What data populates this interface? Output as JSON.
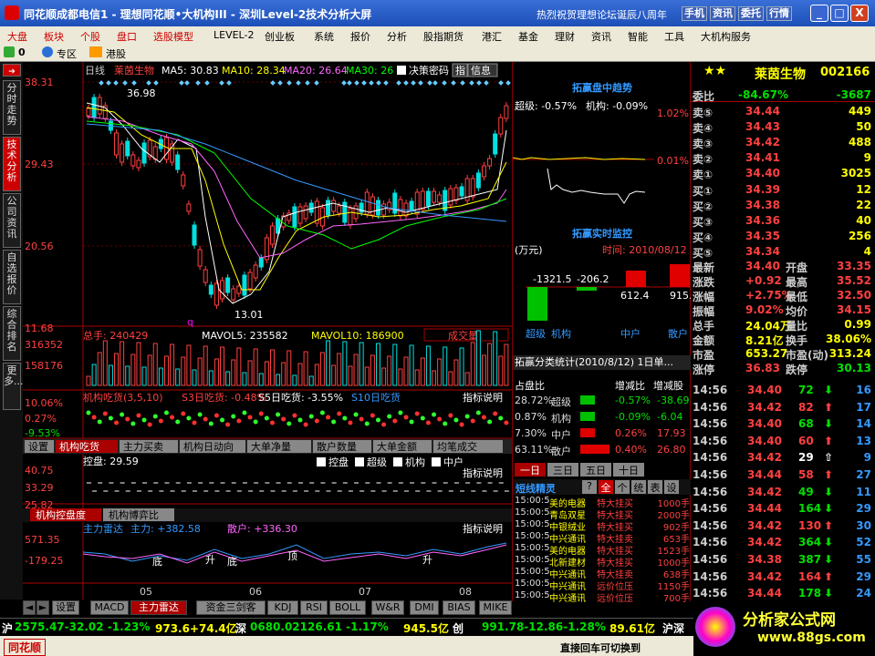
{
  "window": {
    "title": "同花顺成都电信1 - 理想同花顺•大机构III - 深圳Level-2技术分析大屏",
    "promo": "热烈祝贺理想论坛诞辰八周年",
    "buttons": [
      "手机",
      "资讯",
      "委托",
      "行情"
    ],
    "controls": [
      "_",
      "□",
      "X"
    ]
  },
  "menu": [
    "大盘",
    "板块",
    "个股",
    "盘口",
    "选股模型",
    "LEVEL-2",
    "创业板",
    "系统",
    "报价",
    "分析",
    "股指期货",
    "港汇",
    "基金",
    "理财",
    "资讯",
    "智能",
    "工具",
    "大机构服务"
  ],
  "toolbar": {
    "count": "0",
    "zone": "专区",
    "hk": "港股"
  },
  "left_tabs": [
    "分时走势",
    "技术分析",
    "公司资讯",
    "自选报价",
    "综合排名",
    "更多..."
  ],
  "chart": {
    "header_label": "日线",
    "stock": "莱茵生物",
    "ma5": "MA5: 30.83",
    "ma10": "MA10: 28.34",
    "ma20": "MA20: 26.64",
    "ma30": "MA30: 26",
    "toggle": "决策密码",
    "tool1": "指",
    "tool2": "信息",
    "prices": [
      "38.31",
      "29.43",
      "20.56",
      "11.68"
    ],
    "hi_label": "36.98",
    "lo_label": "13.01",
    "q_mark": "q",
    "vol_header": "总手: 240429",
    "mavol5": "MAVOL5: 235582",
    "mavol10": "MAVOL10: 186900",
    "vol_btn": "成交量",
    "vol_ticks": [
      "316352",
      "158176"
    ],
    "jg_header": "机构吃货(3,5,10)",
    "s3": "S3日吃货: -0.48%",
    "s5": "S5日吃货: -3.55%",
    "s10": "S10日吃货",
    "explain": "指标说明",
    "jg_ticks": [
      "10.06%",
      "0.27%",
      "-9.53%"
    ],
    "sub_tabs": [
      "设置",
      "机构吃货",
      "主力买卖",
      "机构日动向",
      "大单净量",
      "散户数量",
      "大单金额",
      "均笔成交"
    ],
    "kp_header": "控盘: 29.59",
    "kp_checks": [
      "控盘",
      "超级",
      "机构",
      "中户"
    ],
    "kp_ticks": [
      "40.75",
      "33.29",
      "25.82"
    ],
    "lower_tabs": [
      "机构控盘度",
      "机构博弈比"
    ],
    "ld_header": "主力雷达",
    "ld_main": "主力: +382.58",
    "ld_retail": "散户: +336.30",
    "ld_ticks": [
      "571.35",
      "-179.25"
    ],
    "ld_marks": [
      "底",
      "升",
      "底",
      "顶",
      "升"
    ],
    "x_labels": [
      "05",
      "06",
      "07",
      "08"
    ]
  },
  "bottom_tabs": [
    "设置",
    "MACD",
    "主力雷达",
    "资金三剑客",
    "KDJ",
    "RSI",
    "BOLL",
    "W&R",
    "DMI",
    "BIAS",
    "MIKE"
  ],
  "mid": {
    "intraday_title": "拓赢盘中趋势",
    "super": "超级: -0.57%",
    "inst": "机构: -0.09%",
    "pct_hi": "1.02%",
    "pct_mid": "0.01%",
    "monitor_title": "拓赢实时监控",
    "unit": "(万元)",
    "time": "时间: 2010/08/12",
    "vals": [
      "-1321.5",
      "-206.2",
      "612.4",
      "915."
    ],
    "cats": [
      "超级",
      "机构",
      "中户",
      "散户"
    ],
    "stat_title": "拓赢分类统计(2010/8/12) 1日单...",
    "stat_head": [
      "占盘比",
      "增减比",
      "增减股"
    ],
    "stat_rows": [
      [
        "28.72%",
        "超级",
        "-0.57%",
        "-38.69"
      ],
      [
        "0.87%",
        "机构",
        "-0.09%",
        "-6.04"
      ],
      [
        "7.30%",
        "中户",
        "0.26%",
        "17.93"
      ],
      [
        "63.11%",
        "散户",
        "0.40%",
        "26.80"
      ]
    ],
    "day_tabs": [
      "一日",
      "三日",
      "五日",
      "十日"
    ],
    "elf_title": "短线精灵",
    "elf_btns": [
      "?",
      "全",
      "个",
      "统",
      "表",
      "设"
    ],
    "elf_rows": [
      [
        "15:00:5",
        "美的电器",
        "特大挂买",
        "1000手"
      ],
      [
        "15:00:5",
        "青岛双星",
        "特大挂买",
        "2000手"
      ],
      [
        "15:00:5",
        "中银绒业",
        "特大挂买",
        "902手"
      ],
      [
        "15:00:5",
        "中兴通讯",
        "特大挂卖",
        "653手"
      ],
      [
        "15:00:5",
        "美的电器",
        "特大挂买",
        "1523手"
      ],
      [
        "15:00:5",
        "北新建材",
        "特大挂买",
        "1000手"
      ],
      [
        "15:00:5",
        "中兴通讯",
        "特大挂卖",
        "638手"
      ],
      [
        "15:00:5",
        "中兴通讯",
        "远价位压",
        "1150手"
      ],
      [
        "15:00:5",
        "中兴通讯",
        "远价位压",
        "700手"
      ]
    ]
  },
  "quote": {
    "name": "莱茵生物",
    "code": "002166",
    "webi_lab": "委比",
    "webi": "-84.67%",
    "weicha": "-3687",
    "sells": [
      [
        "卖⑤",
        "34.44",
        "449"
      ],
      [
        "卖④",
        "34.43",
        "50"
      ],
      [
        "卖③",
        "34.42",
        "488"
      ],
      [
        "卖②",
        "34.41",
        "9"
      ],
      [
        "卖①",
        "34.40",
        "3025"
      ]
    ],
    "buys": [
      [
        "买①",
        "34.39",
        "12"
      ],
      [
        "买②",
        "34.38",
        "22"
      ],
      [
        "买③",
        "34.36",
        "40"
      ],
      [
        "买④",
        "34.35",
        "256"
      ],
      [
        "买⑤",
        "34.34",
        "4"
      ]
    ],
    "stats": [
      [
        "最新",
        "34.40",
        "开盘",
        "33.35"
      ],
      [
        "涨跌",
        "+0.92",
        "最高",
        "35.52"
      ],
      [
        "涨幅",
        "+2.75%",
        "最低",
        "32.50"
      ],
      [
        "振幅",
        "9.02%",
        "均价",
        "34.15"
      ],
      [
        "总手",
        "24.04万",
        "量比",
        "0.99"
      ],
      [
        "金额",
        "8.21亿",
        "换手",
        "38.06%"
      ],
      [
        "市盈",
        "653.27",
        "市盈(动)",
        "313.24"
      ],
      [
        "涨停",
        "36.83",
        "跌停",
        "30.13"
      ]
    ],
    "ticks": [
      [
        "14:56",
        "34.40",
        "72",
        "16"
      ],
      [
        "14:56",
        "34.42",
        "82",
        "17"
      ],
      [
        "14:56",
        "34.40",
        "68",
        "14"
      ],
      [
        "14:56",
        "34.40",
        "60",
        "13"
      ],
      [
        "14:56",
        "34.42",
        "29",
        "9"
      ],
      [
        "14:56",
        "34.44",
        "58",
        "27"
      ],
      [
        "14:56",
        "34.42",
        "49",
        "11"
      ],
      [
        "14:56",
        "34.44",
        "164",
        "29"
      ],
      [
        "14:56",
        "34.42",
        "130",
        "30"
      ],
      [
        "14:56",
        "34.42",
        "364",
        "52"
      ],
      [
        "14:56",
        "34.38",
        "387",
        "55"
      ],
      [
        "14:56",
        "34.42",
        "164",
        "29"
      ],
      [
        "14:56",
        "34.44",
        "178",
        "24"
      ]
    ]
  },
  "ticker": {
    "sh": "沪",
    "sh_val": "2575.47-32.02 -1.23%",
    "sh_amt": "973.6+74.4亿",
    "sz": "深",
    "sz_val": "0680.02126.61 -1.17%",
    "sz_amt": "945.5亿",
    "cy": "创",
    "cy_val": "991.78-12.86-1.28%",
    "cy_amt": "89.61亿",
    "hs": "沪深"
  },
  "status": {
    "brand": "同花顺",
    "msg": "直接回车可切换到",
    "wm_brand": "分析家公式网",
    "wm_url": "www.88gs.com"
  },
  "colors": {
    "up": "#ff4040",
    "down": "#00e000",
    "accent": "#c00000"
  }
}
